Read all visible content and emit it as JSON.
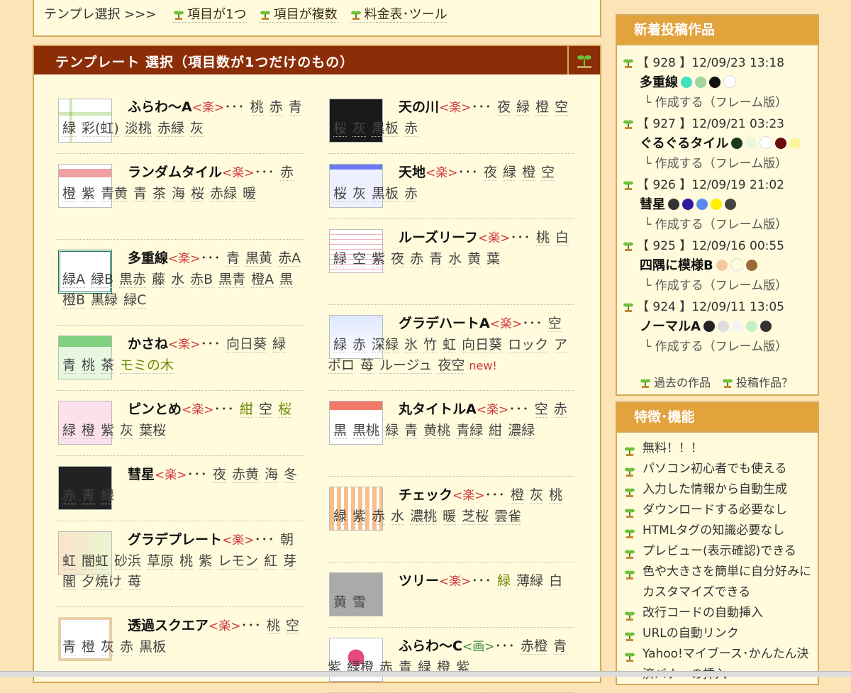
{
  "nav": {
    "prefix": "テンプレ選択 >>>",
    "links": [
      "項目が1つ",
      "項目が複数",
      "料金表･ツール"
    ]
  },
  "main": {
    "title": "テンプレート 選択（項目数が1つだけのもの）"
  },
  "colors": {
    "header": "#8b2e08",
    "side_header": "#e2a23c",
    "panel_bg": "#fffbdc",
    "border": "#d4a95a"
  },
  "left_items": [
    {
      "name": "ふらわ～A",
      "tag": "<楽>",
      "colors": [
        "桃",
        "赤",
        "青",
        "緑",
        "彩(虹)",
        "淡桃",
        "赤緑",
        "灰"
      ],
      "hl": []
    },
    {
      "name": "ランダムタイル",
      "tag": "<楽>",
      "colors": [
        "赤",
        "橙",
        "紫",
        "青黄",
        "青",
        "茶",
        "海",
        "桜",
        "赤緑",
        "暖"
      ],
      "hl": []
    },
    {
      "name": "多重線",
      "tag": "<楽>",
      "colors": [
        "青",
        "黒黄",
        "赤A",
        "緑A",
        "緑B",
        "黒赤",
        "藤",
        "水",
        "赤B",
        "黒青",
        "橙A",
        "黒",
        "橙B",
        "黒緑",
        "緑C"
      ],
      "hl": []
    },
    {
      "name": "かさね",
      "tag": "<楽>",
      "colors": [
        "向日葵",
        "緑",
        "青",
        "桃",
        "茶",
        "モミの木"
      ],
      "hl": [
        5
      ]
    },
    {
      "name": "ピンとめ",
      "tag": "<楽>",
      "colors": [
        "紺",
        "空",
        "桜",
        "緑",
        "橙",
        "紫",
        "灰",
        "葉桜"
      ],
      "hl": [
        0,
        2
      ]
    },
    {
      "name": "彗星",
      "tag": "<楽>",
      "colors": [
        "夜",
        "赤黄",
        "海",
        "冬",
        "赤",
        "青",
        "緑"
      ],
      "hl": []
    },
    {
      "name": "グラデプレート",
      "tag": "<楽>",
      "colors": [
        "朝",
        "虹",
        "闇虹",
        "砂浜",
        "草原",
        "桃",
        "紫",
        "レモン",
        "紅",
        "芽",
        "闇",
        "夕焼け",
        "苺"
      ],
      "hl": []
    },
    {
      "name": "透過スクエア",
      "tag": "<楽>",
      "colors": [
        "桃",
        "空",
        "青",
        "橙",
        "灰",
        "赤",
        "黒板"
      ],
      "hl": []
    }
  ],
  "right_items": [
    {
      "name": "天の川",
      "tag": "<楽>",
      "colors": [
        "夜",
        "緑",
        "橙",
        "空",
        "桜",
        "灰",
        "黒板",
        "赤"
      ],
      "hl": []
    },
    {
      "name": "天地",
      "tag": "<楽>",
      "colors": [
        "夜",
        "緑",
        "橙",
        "空",
        "桜",
        "灰",
        "黒板",
        "赤"
      ],
      "hl": []
    },
    {
      "name": "ルーズリーフ",
      "tag": "<楽>",
      "colors": [
        "桃",
        "白",
        "緑",
        "空",
        "紫",
        "夜",
        "赤",
        "青",
        "水",
        "黄",
        "葉"
      ],
      "hl": []
    },
    {
      "name": "グラデハートA",
      "tag": "<楽>",
      "colors": [
        "空",
        "緑",
        "赤",
        "深緑",
        "氷",
        "竹",
        "虹",
        "向日葵",
        "ロック",
        "アポロ",
        "苺",
        "ルージュ",
        "夜空"
      ],
      "hl": [],
      "new": "new!"
    },
    {
      "name": "丸タイトルA",
      "tag": "<楽>",
      "colors": [
        "空",
        "赤",
        "黒",
        "黒桃",
        "緑",
        "青",
        "黄桃",
        "青緑",
        "紺",
        "濃緑"
      ],
      "hl": []
    },
    {
      "name": "チェック",
      "tag": "<楽>",
      "colors": [
        "橙",
        "灰",
        "桃",
        "緑",
        "紫",
        "赤",
        "水",
        "濃桃",
        "暖",
        "芝桜",
        "雲雀"
      ],
      "hl": []
    },
    {
      "name": "ツリー",
      "tag": "<楽>",
      "colors": [
        "緑",
        "薄緑",
        "白",
        "黄",
        "雪"
      ],
      "hl": [
        0
      ]
    },
    {
      "name": "ふらわ～C",
      "tag": "<画>",
      "colors": [
        "赤橙",
        "青紫",
        "緑橙",
        "赤",
        "青",
        "緑",
        "橙",
        "紫"
      ],
      "hl": []
    }
  ],
  "new_posts": {
    "title": "新着投稿作品",
    "posts": [
      {
        "meta": "【 928 】12/09/23 13:18",
        "name": "多重線",
        "swatches": [
          "#40e0c0",
          "#9fd49f",
          "#111111",
          "#ffffff"
        ],
        "link": "└ 作成する（フレーム版）"
      },
      {
        "meta": "【 927 】12/09/21 03:23",
        "name": "ぐるぐるタイル",
        "swatches": [
          "#1a3a1a",
          "#e8f8e0",
          "#ffffff",
          "#6a0a0a",
          "#fff59a"
        ],
        "link": "└ 作成する（フレーム版）"
      },
      {
        "meta": "【 926 】12/09/19 21:02",
        "name": "彗星",
        "swatches": [
          "#333333",
          "#2a1aa0",
          "#5a8af0",
          "#fff000",
          "#444444"
        ],
        "link": "└ 作成する（フレーム版）"
      },
      {
        "meta": "【 925 】12/09/16 00:55",
        "name": "四隅に模様B",
        "swatches": [
          "#f5c8a0",
          "#fffbdc",
          "#9a6a3a"
        ],
        "link": "└ 作成する（フレーム版）"
      },
      {
        "meta": "【 924 】12/09/11 13:05",
        "name": "ノーマルA",
        "swatches": [
          "#222222",
          "#dddddd",
          "#f4f4f4",
          "#c8f0c8",
          "#333333"
        ],
        "link": "└ 作成する（フレーム版）"
      }
    ],
    "links": [
      "過去の作品",
      "投稿作品？"
    ]
  },
  "features": {
    "title": "特徴･機能",
    "items": [
      "無料！！！",
      "パソコン初心者でも使える",
      "入力した情報から自動生成",
      "ダウンロードする必要なし",
      "HTMLタグの知識必要なし",
      "プレビュー(表示確認)できる",
      "色や大きさを簡単に自分好みにカスタマイズできる",
      "改行コードの自動挿入",
      "URLの自動リンク",
      "Yahoo!マイブース･かんたん決済バナーの挿入"
    ]
  }
}
